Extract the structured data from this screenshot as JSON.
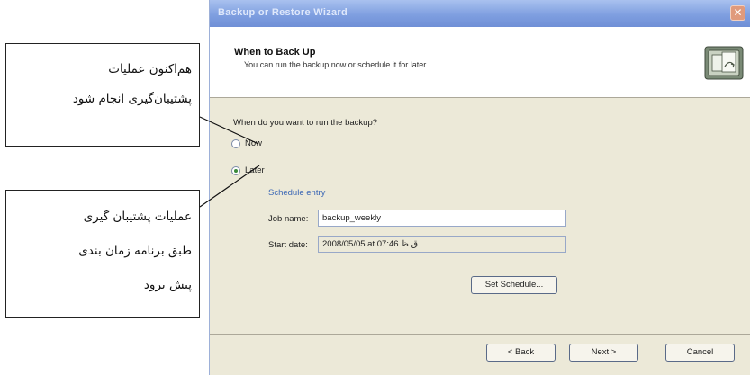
{
  "window": {
    "title": "Backup or Restore Wizard",
    "close_glyph": "✕"
  },
  "header": {
    "title": "When to Back Up",
    "subtitle": "You can run the backup now or schedule it for later.",
    "icon": "backup-wizard-icon"
  },
  "form": {
    "question": "When do you want to run the backup?",
    "option_now": "Now",
    "option_later": "Later",
    "selected_option": "Later",
    "schedule_group_label": "Schedule entry",
    "job_name_label": "Job name:",
    "job_name_value": "backup_weekly",
    "start_date_label": "Start date:",
    "start_date_value": "2008/05/05 at 07:46 ق.ظ",
    "set_schedule_label": "Set Schedule..."
  },
  "buttons": {
    "back": "< Back",
    "next": "Next >",
    "cancel": "Cancel"
  },
  "annotations": {
    "now_note": [
      "هم‌اکنون عملیات",
      "پشتیبان‌گیری انجام شود"
    ],
    "later_note": [
      "عملیات پشتیبان گیری",
      "طبق  برنامه زمان بندی",
      "پیش برود"
    ]
  },
  "colors": {
    "titlebar": "#7f9fe0",
    "dialog_bg": "#ece9d8",
    "group_label": "#3b67b5"
  }
}
